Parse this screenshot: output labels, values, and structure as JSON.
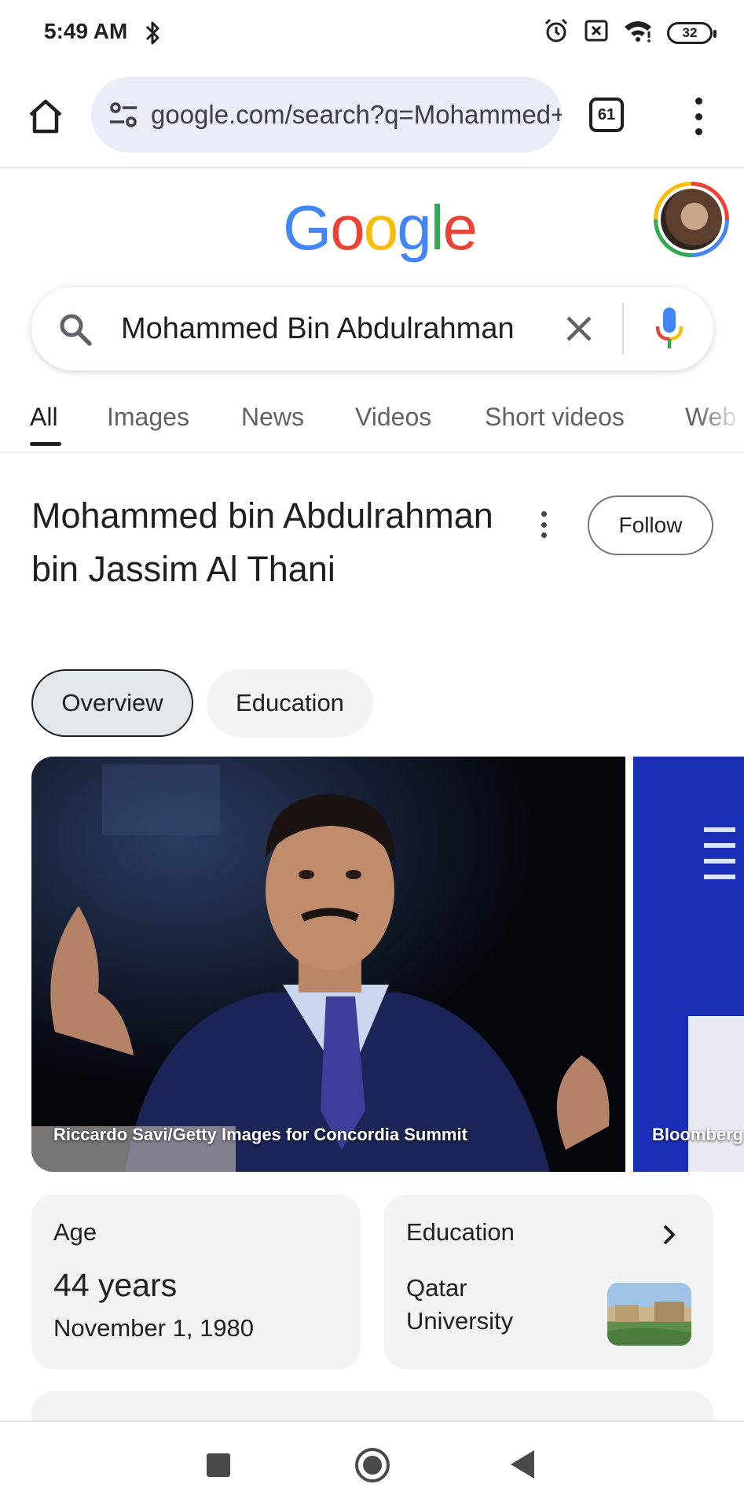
{
  "status_bar": {
    "time": "5:49 AM",
    "battery": "32",
    "icons": [
      "bluetooth-icon",
      "alarm-icon",
      "no-sim-icon",
      "wifi-icon",
      "battery-icon"
    ]
  },
  "browser": {
    "url": "google.com/search?q=Mohammed+Bin+Abdulrahman",
    "tab_count": "61",
    "icons": [
      "home-icon",
      "site-settings-icon",
      "tab-switcher-icon",
      "more-vert-icon"
    ]
  },
  "google": {
    "logo_letters": [
      "G",
      "o",
      "o",
      "g",
      "l",
      "e"
    ],
    "logo_colors": [
      "#4285f4",
      "#ea4335",
      "#fbbc05",
      "#4285f4",
      "#34a853",
      "#ea4335"
    ]
  },
  "search": {
    "query": "Mohammed Bin Abdulrahman",
    "icons": [
      "search-icon",
      "clear-icon",
      "mic-icon"
    ]
  },
  "tabs": [
    {
      "label": "All",
      "active": true
    },
    {
      "label": "Images",
      "active": false
    },
    {
      "label": "News",
      "active": false
    },
    {
      "label": "Videos",
      "active": false
    },
    {
      "label": "Short videos",
      "active": false
    },
    {
      "label": "Web",
      "active": false
    }
  ],
  "knowledge_panel": {
    "title": "Mohammed bin Abdulrahman bin Jassim Al Thani",
    "follow_label": "Follow",
    "chips": [
      {
        "label": "Overview",
        "selected": true
      },
      {
        "label": "Education",
        "selected": false
      }
    ],
    "images": [
      {
        "caption": "Riccardo Savi/Getty Images for Concordia Summit"
      },
      {
        "caption": "Bloomberg"
      }
    ],
    "age_card": {
      "label": "Age",
      "value": "44 years",
      "date": "November 1, 1980"
    },
    "education_card": {
      "label": "Education",
      "value": "Qatar University"
    }
  },
  "nav_bar": {
    "icons": [
      "recents-icon",
      "home-icon",
      "back-icon"
    ]
  }
}
